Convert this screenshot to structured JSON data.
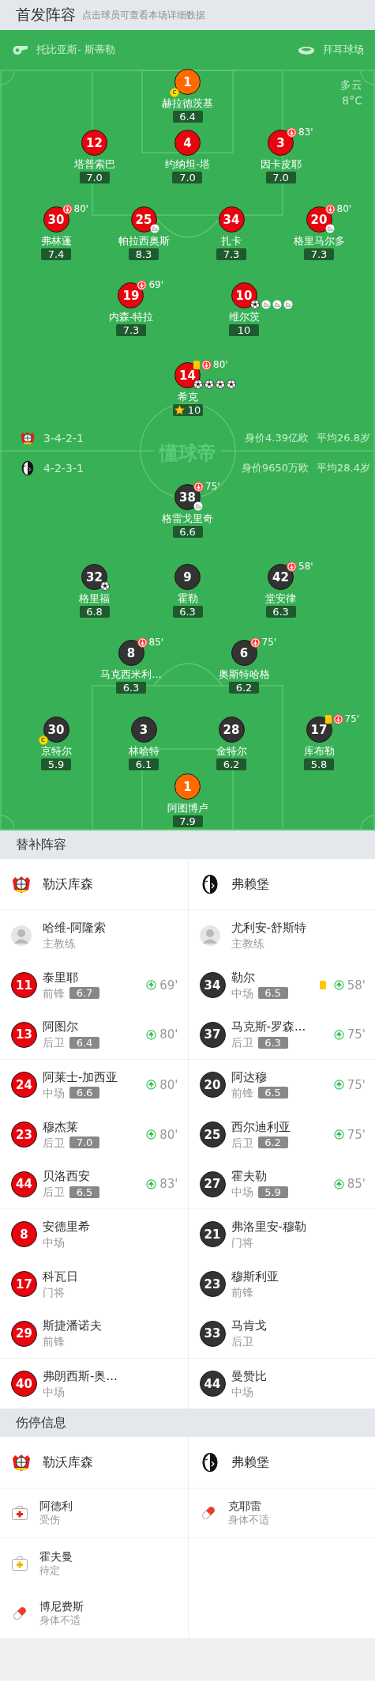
{
  "header": {
    "title": "首发阵容",
    "subtitle": "点击球员可查看本场详细数据"
  },
  "pitch": {
    "referee": "托比亚斯- 斯蒂勒",
    "stadium": "拜耳球场",
    "weather": {
      "condition": "多云",
      "temperature": "8°C"
    },
    "logo": "懂球帝",
    "home": {
      "formation": "3-4-2-1",
      "market_value": "身价4.39亿欧",
      "average_age": "平均26.8岁",
      "goalkeeper": {
        "number": "1",
        "name": "赫拉德茨基",
        "rating": "6.4",
        "captain": "C"
      },
      "rows": [
        [
          {
            "number": "12",
            "name": "塔普索巴",
            "rating": "7.0"
          },
          {
            "number": "4",
            "name": "约纳坦-塔",
            "rating": "7.0"
          },
          {
            "number": "3",
            "name": "因卡皮耶",
            "rating": "7.0",
            "sub_off": "83'"
          }
        ],
        [
          {
            "number": "30",
            "name": "弗林蓬",
            "rating": "7.4",
            "sub_off": "80'"
          },
          {
            "number": "25",
            "name": "帕拉西奥斯",
            "rating": "8.3",
            "events": [
              {
                "kind": "assist"
              }
            ]
          },
          {
            "number": "34",
            "name": "扎卡",
            "rating": "7.3"
          },
          {
            "number": "20",
            "name": "格里马尔多",
            "rating": "7.3",
            "sub_off": "80'",
            "events": [
              {
                "kind": "assist"
              }
            ]
          }
        ],
        [
          {
            "number": "19",
            "name": "内森-特拉",
            "rating": "7.3",
            "sub_off": "69'"
          },
          {
            "number": "10",
            "name": "维尔茨",
            "rating": "10",
            "events": [
              {
                "kind": "goal"
              },
              {
                "kind": "assist"
              },
              {
                "kind": "assist"
              },
              {
                "kind": "assist"
              }
            ]
          }
        ],
        [
          {
            "number": "14",
            "name": "希克",
            "rating": "10",
            "motm": true,
            "yellow_card": true,
            "sub_off": "80'",
            "events": [
              {
                "kind": "goal"
              },
              {
                "kind": "goal"
              },
              {
                "kind": "goal"
              },
              {
                "kind": "goal"
              }
            ]
          }
        ]
      ]
    },
    "away": {
      "formation": "4-2-3-1",
      "market_value": "身价9650万欧",
      "average_age": "平均28.4岁",
      "rows": [
        [
          {
            "number": "38",
            "name": "格雷戈里奇",
            "rating": "6.6",
            "sub_off": "75'",
            "events": [
              {
                "kind": "assist"
              }
            ]
          }
        ],
        [
          {
            "number": "32",
            "name": "格里福",
            "rating": "6.8",
            "events": [
              {
                "kind": "goal"
              }
            ]
          },
          {
            "number": "9",
            "name": "霍勒",
            "rating": "6.3"
          },
          {
            "number": "42",
            "name": "堂安律",
            "rating": "6.3",
            "sub_off": "58'"
          }
        ],
        [
          {
            "number": "8",
            "name": "马克西米利...",
            "rating": "6.3",
            "sub_off": "85'"
          },
          {
            "number": "6",
            "name": "奥斯特哈格",
            "rating": "6.2",
            "sub_off": "75'"
          }
        ],
        [
          {
            "number": "30",
            "name": "京特尔",
            "rating": "5.9",
            "captain": "C"
          },
          {
            "number": "3",
            "name": "林哈特",
            "rating": "6.1"
          },
          {
            "number": "28",
            "name": "金特尔",
            "rating": "6.2"
          },
          {
            "number": "17",
            "name": "库布勒",
            "rating": "5.8",
            "yellow_card": true,
            "sub_off": "75'"
          }
        ]
      ],
      "goalkeeper": {
        "number": "1",
        "name": "阿图博卢",
        "rating": "7.9"
      }
    }
  },
  "substitutes": {
    "title": "替补阵容",
    "home": {
      "team": "勒沃库森",
      "coach": {
        "name": "哈维-阿隆索",
        "role": "主教练"
      },
      "players": [
        {
          "number": "11",
          "name": "泰里耶",
          "position": "前锋",
          "rating": "6.7",
          "sub_on": "69'"
        },
        {
          "number": "13",
          "name": "阿图尔",
          "position": "后卫",
          "rating": "6.4",
          "sub_on": "80'"
        },
        {
          "number": "24",
          "name": "阿莱士-加西亚",
          "position": "中场",
          "rating": "6.6",
          "sub_on": "80'"
        },
        {
          "number": "23",
          "name": "穆杰莱",
          "position": "后卫",
          "rating": "7.0",
          "sub_on": "80'"
        },
        {
          "number": "44",
          "name": "贝洛西安",
          "position": "后卫",
          "rating": "6.5",
          "sub_on": "83'"
        },
        {
          "number": "8",
          "name": "安德里希",
          "position": "中场"
        },
        {
          "number": "17",
          "name": "科瓦日",
          "position": "门将"
        },
        {
          "number": "29",
          "name": "斯捷潘诺夫",
          "position": "前锋"
        },
        {
          "number": "40",
          "name": "弗朗西斯-奥...",
          "position": "中场"
        }
      ]
    },
    "away": {
      "team": "弗赖堡",
      "coach": {
        "name": "尤利安-舒斯特",
        "role": "主教练"
      },
      "players": [
        {
          "number": "34",
          "name": "勒尔",
          "position": "中场",
          "rating": "6.5",
          "yellow_card": true,
          "sub_on": "58'"
        },
        {
          "number": "37",
          "name": "马克斯-罗森...",
          "position": "后卫",
          "rating": "6.3",
          "sub_on": "75'"
        },
        {
          "number": "20",
          "name": "阿达穆",
          "position": "前锋",
          "rating": "6.5",
          "sub_on": "75'"
        },
        {
          "number": "25",
          "name": "西尔迪利亚",
          "position": "后卫",
          "rating": "6.2",
          "sub_on": "75'"
        },
        {
          "number": "27",
          "name": "霍夫勒",
          "position": "中场",
          "rating": "5.9",
          "sub_on": "85'"
        },
        {
          "number": "21",
          "name": "弗洛里安-穆勒",
          "position": "门将"
        },
        {
          "number": "23",
          "name": "穆斯利亚",
          "position": "前锋"
        },
        {
          "number": "33",
          "name": "马肯戈",
          "position": "后卫"
        },
        {
          "number": "44",
          "name": "曼赞比",
          "position": "中场"
        }
      ]
    }
  },
  "injuries": {
    "title": "伤停信息",
    "home": {
      "team": "勒沃库森",
      "players": [
        {
          "name": "阿德利",
          "status": "受伤",
          "kind": "injury"
        },
        {
          "name": "霍夫曼",
          "status": "待定",
          "kind": "doubtful"
        },
        {
          "name": "博尼费斯",
          "status": "身体不适",
          "kind": "illness"
        }
      ]
    },
    "away": {
      "team": "弗赖堡",
      "players": [
        {
          "name": "克耶雷",
          "status": "身体不适",
          "kind": "illness"
        }
      ]
    }
  }
}
